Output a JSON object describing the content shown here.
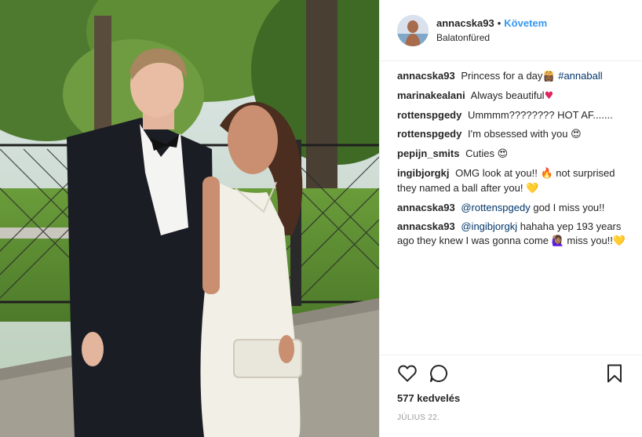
{
  "post": {
    "username": "annacska93",
    "separator": "•",
    "follow_label": "Követem",
    "location": "Balatonfüred",
    "likes": "577 kedvelés",
    "date": "július 22."
  },
  "icons": {
    "like": "heart-outline-icon",
    "comment": "speech-bubble-icon",
    "save": "bookmark-icon"
  },
  "comments": [
    {
      "user": "annacska93",
      "text": "Princess for a day",
      "emoji": "👸🏾",
      "tag": "#annaball"
    },
    {
      "user": "marinakealani",
      "text": "Always beautiful",
      "emoji": "♥"
    },
    {
      "user": "rottenspgedy",
      "text": "Ummmm???????? HOT AF......."
    },
    {
      "user": "rottenspgedy",
      "text": "I'm obsessed with you",
      "emoji": "😍"
    },
    {
      "user": "pepijn_smits",
      "text": "Cuties",
      "emoji": "😍"
    },
    {
      "user": "ingibjorgkj",
      "text": "OMG look at you!!",
      "emoji": "🔥",
      "text2": "not surprised they named a ball after you!",
      "emoji2": "💛"
    },
    {
      "user": "annacska93",
      "mention": "@rottenspgedy",
      "text": "god I miss you!!"
    },
    {
      "user": "annacska93",
      "mention": "@ingibjorgkj",
      "text": "hahaha yep 193 years ago they knew I was gonna come",
      "emoji": "🙋🏽‍♀",
      "text2": "miss you!!",
      "emoji2": "💛"
    }
  ],
  "colors": {
    "follow": "#3897f0",
    "mention": "#003569",
    "muted": "#999999",
    "border": "#efefef"
  }
}
